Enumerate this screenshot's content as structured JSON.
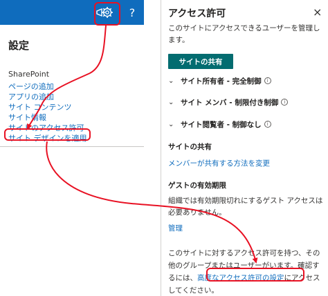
{
  "left": {
    "title": "設定",
    "section": "SharePoint",
    "links": [
      "ページの追加",
      "アプリの追加",
      "サイト コンテンツ",
      "サイト情報",
      "サイトのアクセス許可",
      "サイト デザインを適用"
    ],
    "icons": {
      "megaphone": "megaphone-icon",
      "gear": "gear-icon",
      "help": "?"
    }
  },
  "right": {
    "title": "アクセス許可",
    "close": "×",
    "description": "このサイトにアクセスできるユーザーを管理します。",
    "share_button": "サイトの共有",
    "groups": [
      "サイト所有者 - 完全制御",
      "サイト メンバ - 制限付き制御",
      "サイト閲覧者 - 制御なし"
    ],
    "share_section": "サイトの共有",
    "share_link": "メンバーが共有する方法を変更",
    "guest_section": "ゲストの有効期限",
    "guest_desc": "組織では有効期限切れにするゲスト アクセスは必要ありません。",
    "manage_link": "管理",
    "perm_desc_before": "このサイトに対するアクセス許可を持つ、その他のグループまたはユーザーがいます。確認するには、",
    "advanced_link": "高度なアクセス許可の設定",
    "perm_desc_after": "にアクセスしてください。"
  },
  "colors": {
    "accent": "#0f6cbd",
    "share_button": "#036c70",
    "annotation": "#e81123"
  }
}
